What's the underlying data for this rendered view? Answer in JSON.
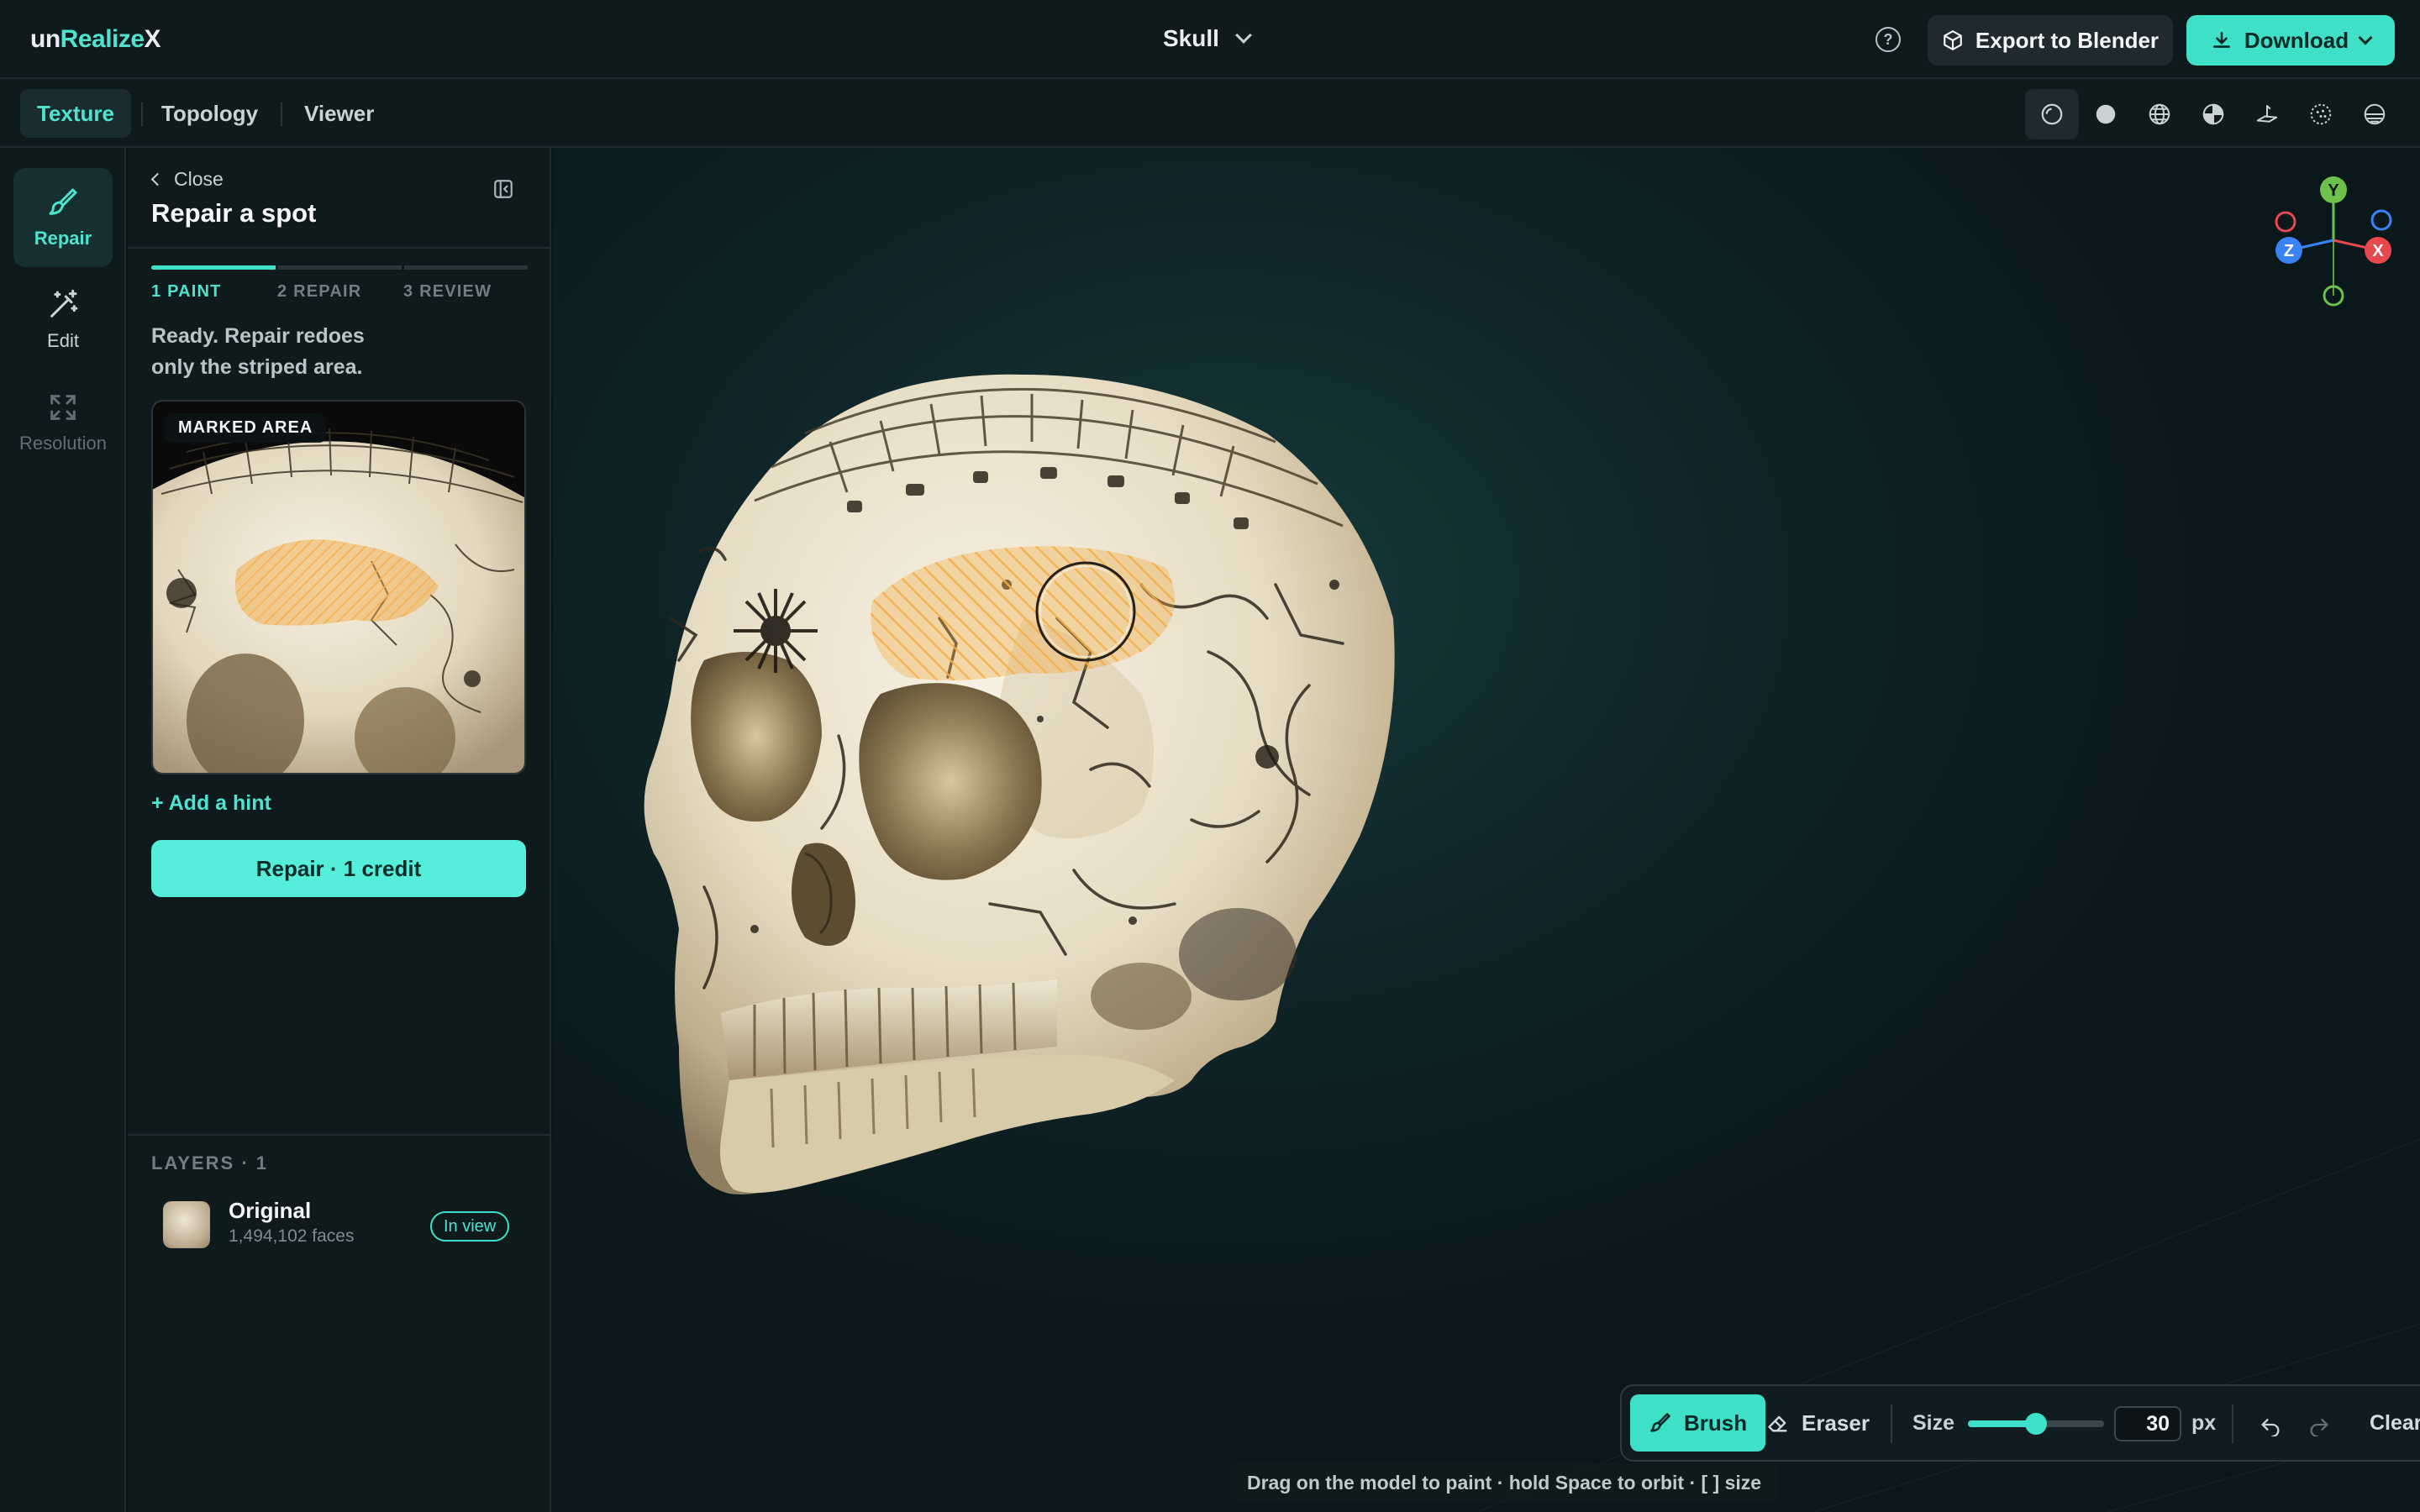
{
  "app": {
    "logo_prefix": "un",
    "logo_accent": "Realize",
    "logo_suffix": "X",
    "title": "Skull",
    "help_icon": "question-circle-icon",
    "export_label": "Export to Blender",
    "download_label": "Download"
  },
  "tabs": [
    "Texture",
    "Topology",
    "Viewer"
  ],
  "active_tab": "Texture",
  "view_modes": [
    "matcap-icon",
    "solid-icon",
    "wireframe-icon",
    "uv-sphere-icon",
    "plane-icon",
    "dotted-sphere-icon",
    "half-sphere-icon"
  ],
  "rail": {
    "items": [
      {
        "label": "Repair",
        "icon": "brush-icon",
        "state": "active"
      },
      {
        "label": "Edit",
        "icon": "magic-wand-icon",
        "state": "normal"
      },
      {
        "label": "Resolution",
        "icon": "expand-icon",
        "state": "disabled"
      }
    ]
  },
  "panel": {
    "close_label": "Close",
    "title": "Repair a spot",
    "steps": [
      "1 PAINT",
      "2 REPAIR",
      "3 REVIEW"
    ],
    "active_step": 1,
    "status_text": "Ready. Repair redoes only the striped area.",
    "preview_badge": "MARKED AREA",
    "hint_link": "+ Add a hint",
    "repair_button": "Repair · 1 credit"
  },
  "layers": {
    "title": "LAYERS · 1",
    "items": [
      {
        "name": "Original",
        "faces": "1,494,102 faces",
        "badge": "In view"
      }
    ]
  },
  "gizmo": {
    "axes": [
      "Y",
      "Z",
      "X"
    ],
    "colors": {
      "x": "#e5484d",
      "y": "#6cc24a",
      "z": "#3b82f6"
    }
  },
  "toolbar": {
    "brush_label": "Brush",
    "eraser_label": "Eraser",
    "size_label": "Size",
    "size_value": "30",
    "size_fraction": 0.5,
    "unit": "px",
    "clear_label": "Clear"
  },
  "viewport_hint": "Drag on the model to paint · hold Space to orbit · [ ] size",
  "colors": {
    "accent": "#3fe0c8",
    "background": "#0f1a1d",
    "mask": "#f0a53a"
  }
}
